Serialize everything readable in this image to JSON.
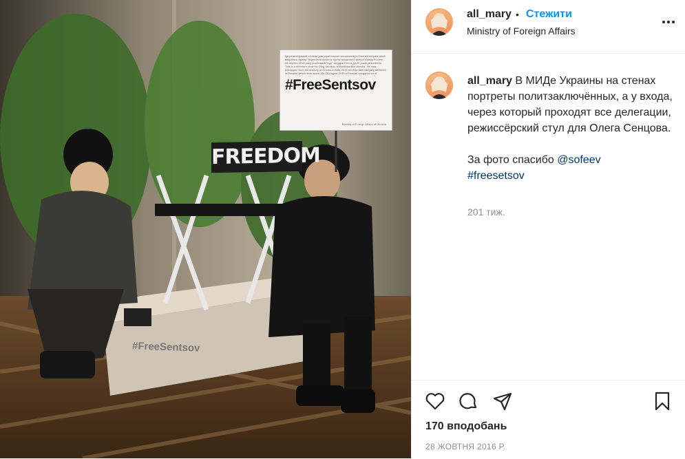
{
  "header": {
    "username": "all_mary",
    "separator": "•",
    "follow_label": "Стежити",
    "location": "Ministry of Foreign Affairs",
    "more_icon": "more-horizontal-icon"
  },
  "photo": {
    "sign_small": "Це режисерський стілець для українського кінорежисера Олега Сенцова, який викрали в Криму. Через його протест проти незаконної анексії Криму Росією, 25 серпня 2015 року російський \"суд\" засудив Олега до 20 років ув'язнення. This is a director's chair for Oleg Sentsov, a Ukrainian film director. He was kidnapped from the territory of Crimea in May 2014 and has been illegally detained in Russian prison ever since. On 25 August 2015 a Russian kangaroo court sentenced Oleg to 20 years in prison on fabricated charges of terrorism. Oleg Sentsov is an artist who should sit on this director's chair and not in a Russian prison.",
    "sign_hashtag": "#FreeSentsov",
    "sign_footer": "Ministry of Foreign Affairs of Ukraine",
    "chair_label": "FREEDOM",
    "box_label": "#FreeSentsov"
  },
  "caption": {
    "username": "all_mary",
    "text": " В МИДе Украины на стенах портреты политзаключённых, а у входа, через который проходят все делегации, режиссёрский стул для Олега Сенцова.",
    "thanks": "За фото спасибо ",
    "mention": "@sofeev",
    "hashtag": "#freesetsov",
    "age": "201 тиж."
  },
  "actions": {
    "like_icon": "heart-icon",
    "comment_icon": "comment-icon",
    "share_icon": "share-icon",
    "save_icon": "bookmark-icon",
    "likes_text": "170 вподобань",
    "date_text": "28 ЖОВТНЯ 2016 Р."
  },
  "colors": {
    "accent": "#0095f6",
    "link": "#00376b",
    "muted": "#8e8e8e",
    "border": "#efefef"
  }
}
